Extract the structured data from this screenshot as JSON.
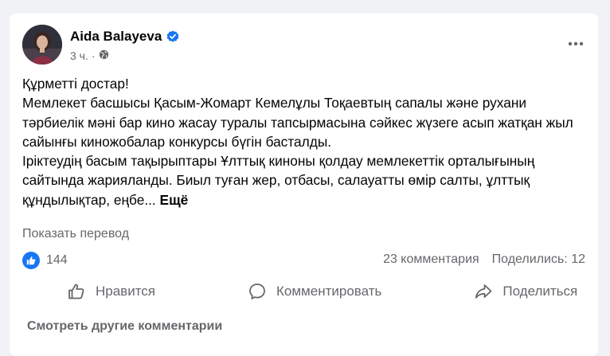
{
  "post": {
    "author": "Aida Balayeva",
    "time": "3 ч.",
    "time_separator": "·",
    "text_lines": [
      "Құрметті достар!",
      "Мемлекет басшысы Қасым-Жомарт Кемелұлы Тоқаевтың сапалы және рухани тәрбиелік мәні бар кино жасау туралы тапсырмасына сәйкес жүзеге асып жатқан жыл сайынғы киножобалар конкурсы бүгін басталды.",
      "Іріктеудің басым тақырыптары Ұлттық киноны қолдау мемлекеттік орталығының сайтында жарияланды. Биыл туған жер, отбасы, салауатты өмір салты, ұлттық құндылықтар, еңбе..."
    ],
    "see_more": "Ещё",
    "translate": "Показать перевод"
  },
  "stats": {
    "likes": "144",
    "comments": "23 комментария",
    "shares": "Поделились: 12"
  },
  "actions": {
    "like": "Нравится",
    "comment": "Комментировать",
    "share": "Поделиться"
  },
  "comments": {
    "view_more": "Смотреть другие комментарии"
  },
  "icons": {
    "verified": "verified-badge-icon",
    "privacy": "globe-icon",
    "more": "more-options-icon",
    "like_reaction": "like-reaction-icon",
    "like": "thumbs-up-icon",
    "comment": "comment-bubble-icon",
    "share": "share-arrow-icon"
  },
  "colors": {
    "brand_blue": "#1877f2",
    "secondary_text": "#65676b",
    "card_bg": "#ffffff",
    "page_bg": "#f0f2f5"
  }
}
